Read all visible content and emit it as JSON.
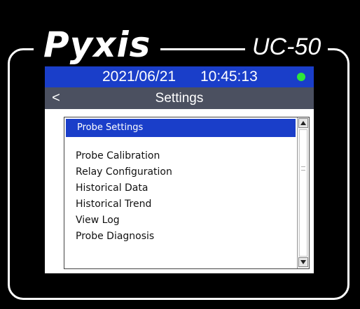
{
  "device": {
    "brand": "Pyxis",
    "model": "UC-50"
  },
  "status_bar": {
    "date": "2021/06/21",
    "time": "10:45:13",
    "indicator_color": "#2ee63a",
    "background_color": "#1a3ec9"
  },
  "title_bar": {
    "back_label": "<",
    "title": "Settings",
    "background_color": "#4b5060"
  },
  "menu": {
    "selected_index": 0,
    "items": [
      {
        "label": "Probe Settings"
      },
      {
        "label": "Probe Calibration"
      },
      {
        "label": "Relay Configuration"
      },
      {
        "label": "Historical Data"
      },
      {
        "label": "Historical Trend"
      },
      {
        "label": "View Log"
      },
      {
        "label": "Probe Diagnosis"
      }
    ]
  },
  "scrollbar": {
    "up_icon": "arrow-up-icon",
    "down_icon": "arrow-down-icon"
  }
}
